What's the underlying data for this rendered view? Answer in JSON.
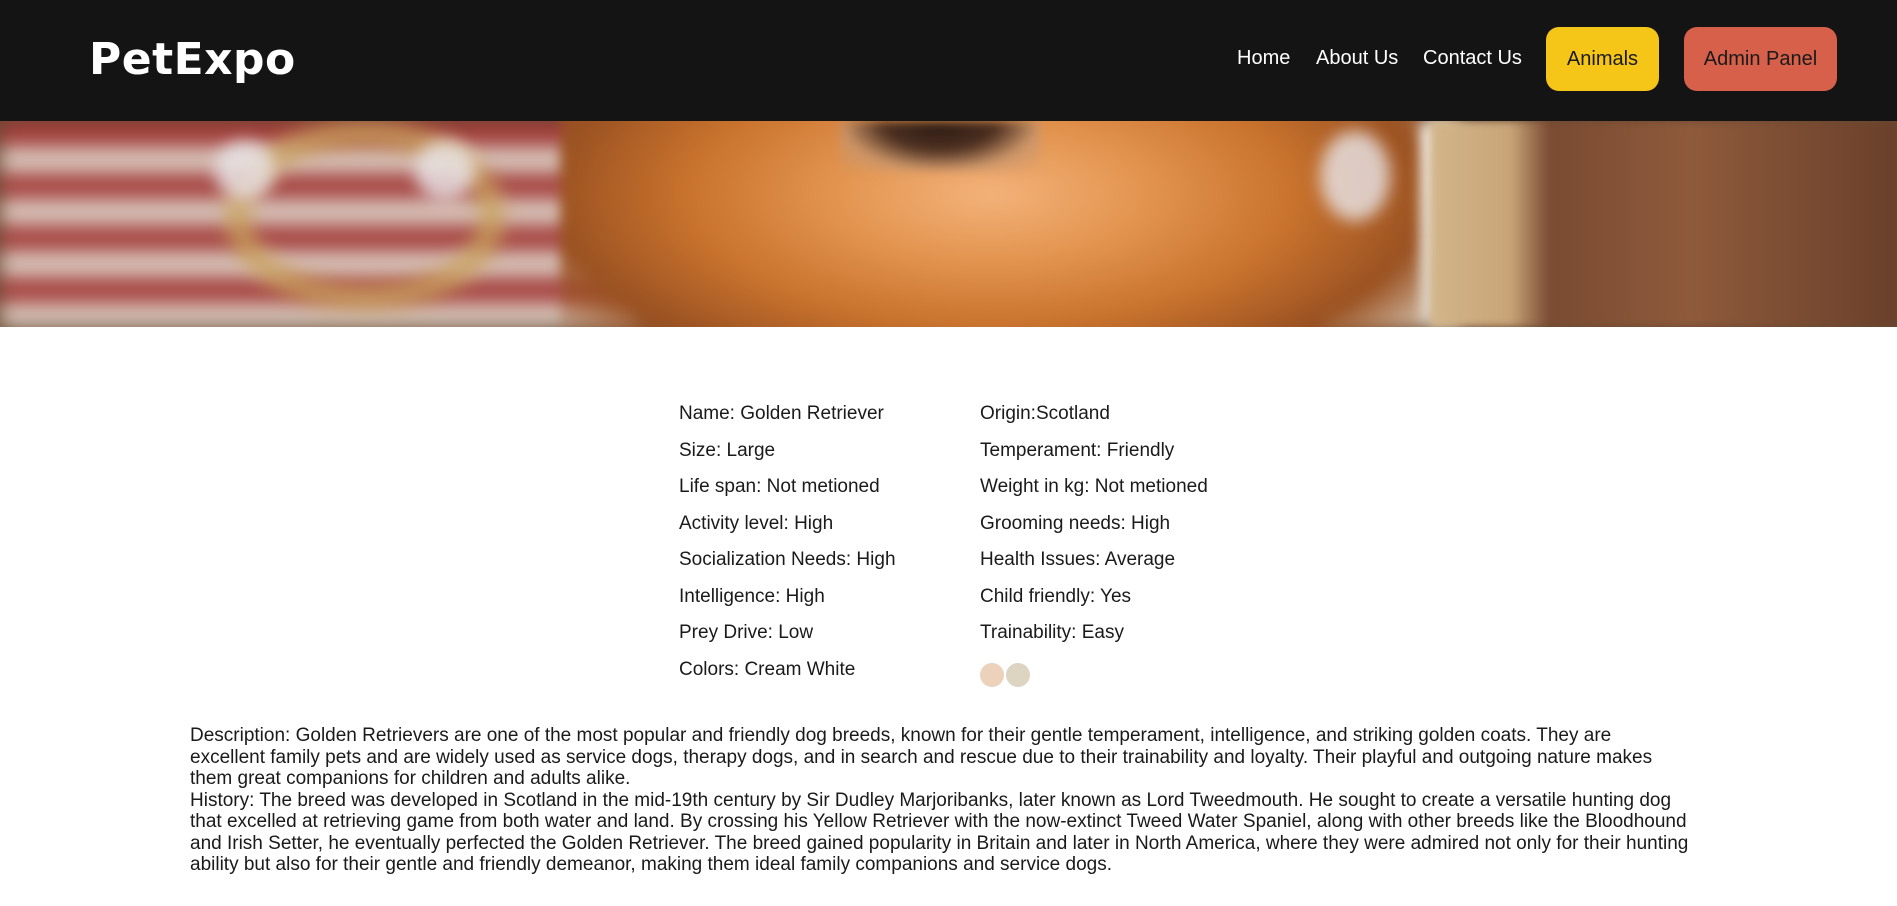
{
  "navbar": {
    "logo": "PetExpo",
    "links": [
      {
        "label": "Home"
      },
      {
        "label": "About Us"
      },
      {
        "label": "Contact Us"
      }
    ],
    "animals_button": {
      "label": "Animals",
      "color": "#f5c518"
    },
    "admin_button": {
      "label": "Admin Panel",
      "color": "#d6604a"
    }
  },
  "hero": {
    "image": "golden-retriever-hero-image"
  },
  "details": {
    "name": "Name: Golden Retriever",
    "origin": "Origin:Scotland",
    "size": "Size: Large",
    "temperament": "Temperament: Friendly",
    "life_span": "Life span: Not metioned",
    "weight": "Weight in kg: Not metioned",
    "activity_level": "Activity level: High",
    "grooming_needs": "Grooming needs: High",
    "socialization_needs": "Socialization Needs: High",
    "health_issues": "Health Issues: Average",
    "intelligence": "Intelligence: High",
    "child_friendly": "Child friendly: Yes",
    "prey_drive": "Prey Drive: Low",
    "trainability": "Trainability: Easy",
    "colors": "Colors: Cream White",
    "color_swatches": [
      "#ecd2bb",
      "#ddd5c2"
    ]
  },
  "description": "Description: Golden Retrievers are one of the most popular and friendly dog breeds, known for their gentle temperament, intelligence, and striking golden coats. They are excellent family pets and are widely used as service dogs, therapy dogs, and in search and rescue due to their trainability and loyalty. Their playful and outgoing nature makes them great companions for children and adults alike.",
  "history": "History: The breed was developed in Scotland in the mid-19th century by Sir Dudley Marjoribanks, later known as Lord Tweedmouth. He sought to create a versatile hunting dog that excelled at retrieving game from both water and land. By crossing his Yellow Retriever with the now-extinct Tweed Water Spaniel, along with other breeds like the Bloodhound and Irish Setter, he eventually perfected the Golden Retriever. The breed gained popularity in Britain and later in North America, where they were admired not only for their hunting ability but also for their gentle and friendly demeanor, making them ideal family companions and service dogs."
}
